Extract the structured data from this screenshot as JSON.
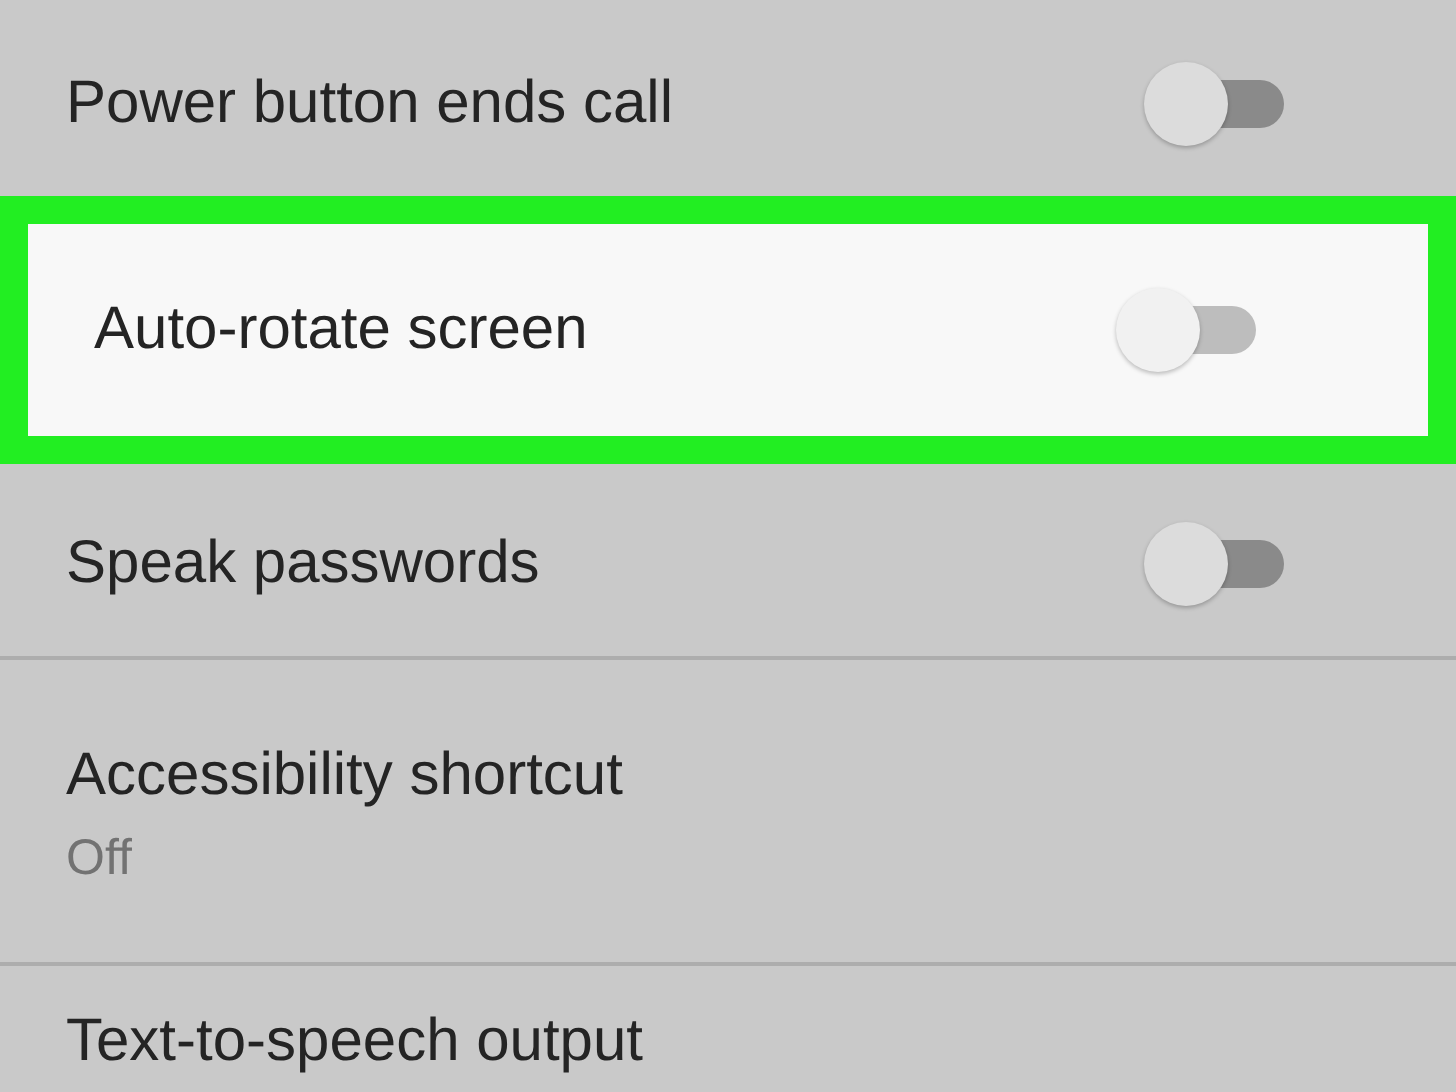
{
  "settings": [
    {
      "kind": "toggle",
      "label": "Power button ends call",
      "on": false,
      "highlighted": false
    },
    {
      "kind": "toggle",
      "label": "Auto-rotate screen",
      "on": false,
      "highlighted": true
    },
    {
      "kind": "toggle",
      "label": "Speak passwords",
      "on": false,
      "highlighted": false
    },
    {
      "kind": "text",
      "label": "Accessibility shortcut",
      "summary": "Off",
      "highlighted": false
    },
    {
      "kind": "text",
      "label": "Text-to-speech output",
      "highlighted": false
    }
  ]
}
